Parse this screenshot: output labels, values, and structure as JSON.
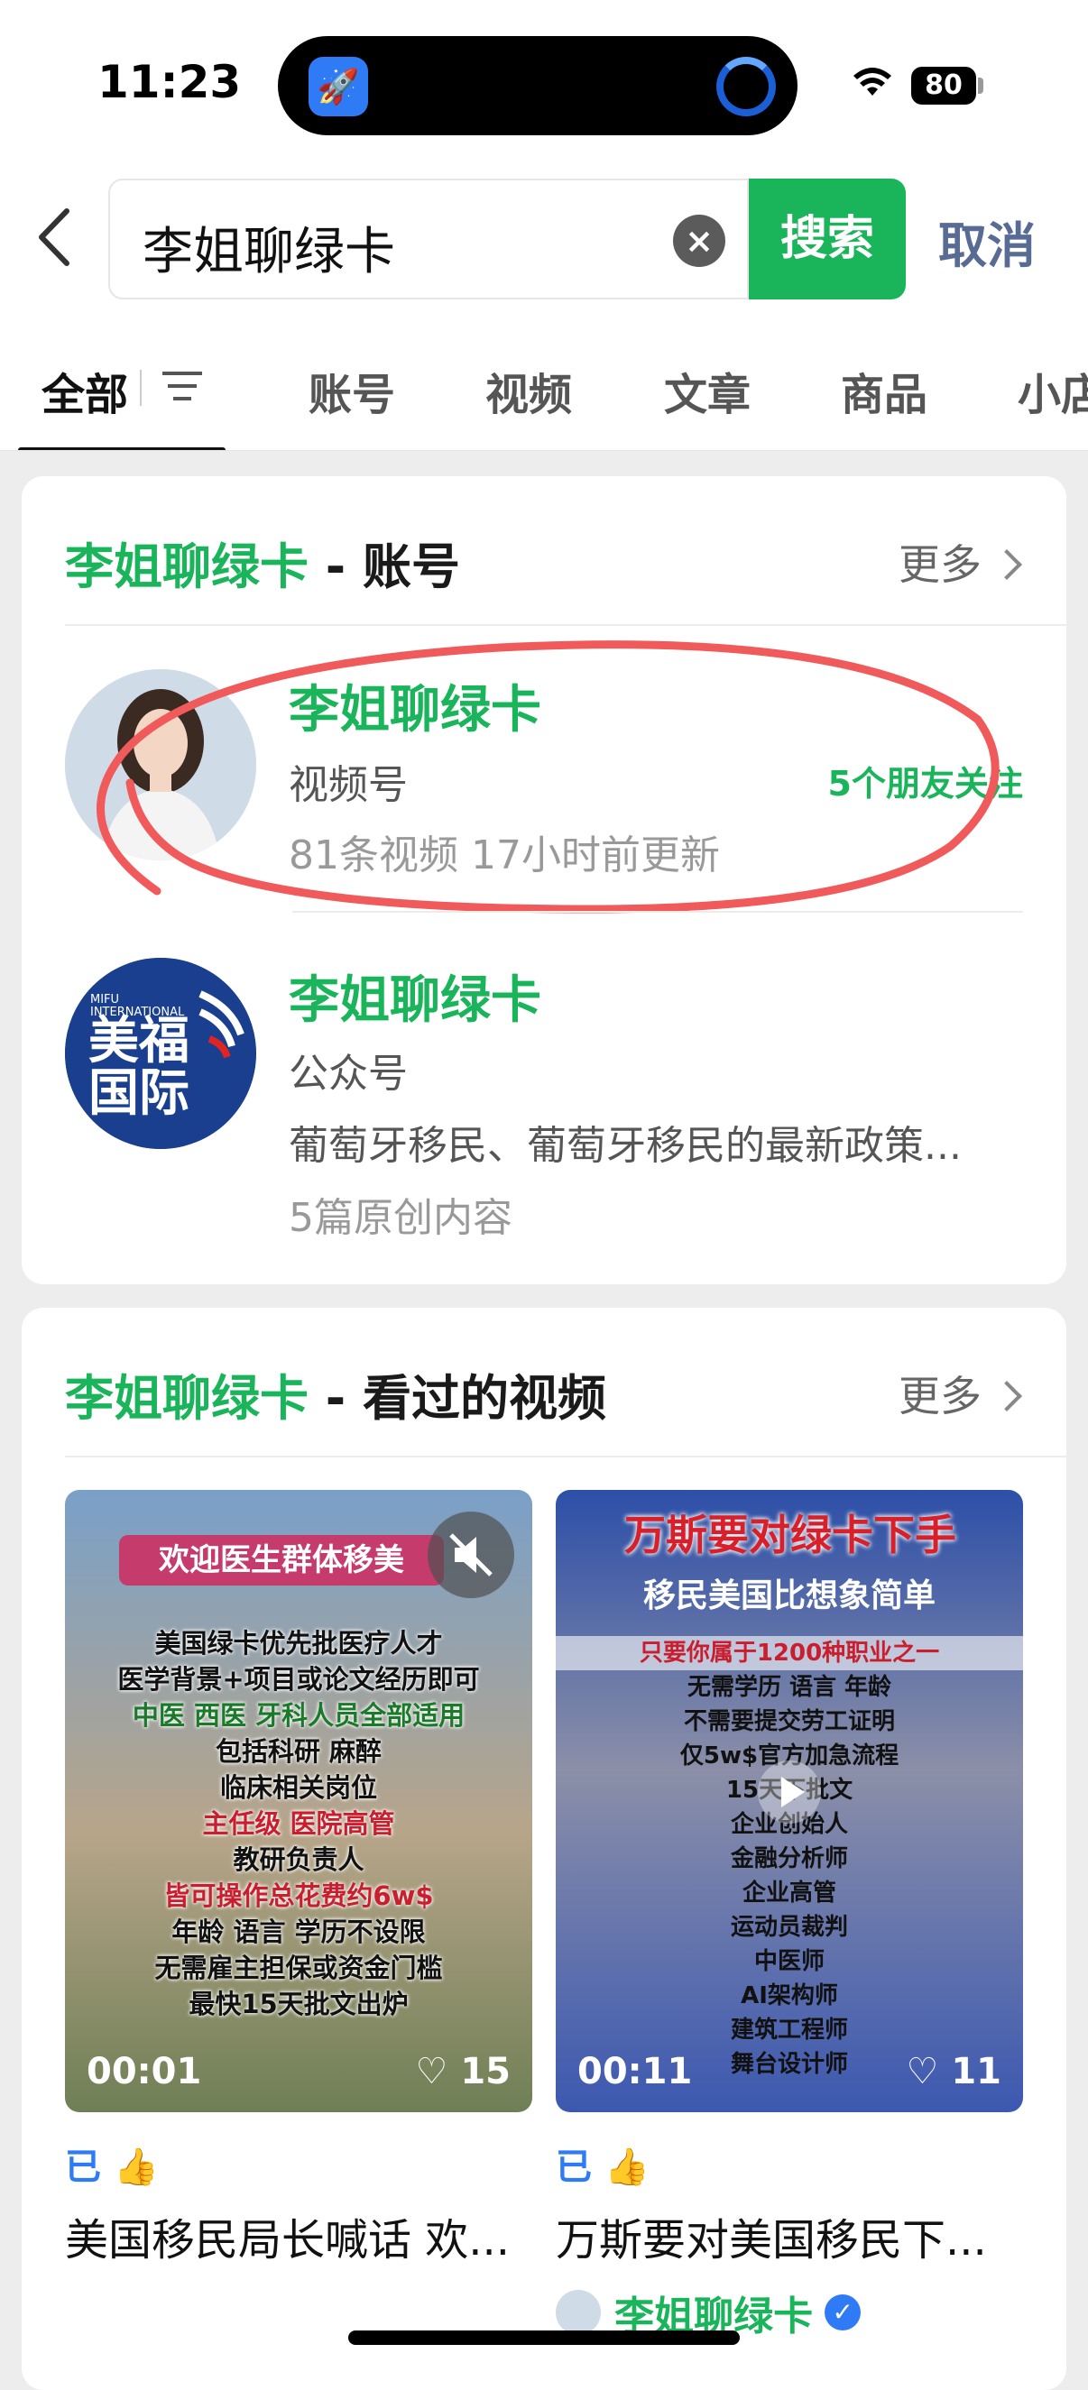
{
  "status": {
    "time": "11:23",
    "battery": "80"
  },
  "search": {
    "query": "李姐聊绿卡",
    "button": "搜索",
    "cancel": "取消"
  },
  "tabs": [
    "全部",
    "账号",
    "视频",
    "文章",
    "商品",
    "小店"
  ],
  "accounts_section": {
    "title_keyword": "李姐聊绿卡",
    "title_suffix": " - 账号",
    "more": "更多",
    "items": [
      {
        "name": "李姐聊绿卡",
        "type": "视频号",
        "meta": "81条视频  17小时前更新",
        "follow": "5个朋友关注"
      },
      {
        "name": "李姐聊绿卡",
        "type": "公众号",
        "desc": "葡萄牙移民、葡萄牙移民的最新政策...",
        "meta": "5篇原创内容",
        "logo_en": "MIFU INTERNATIONAL",
        "logo_cn_1": "美福",
        "logo_cn_2": "国际"
      }
    ]
  },
  "videos_section": {
    "title_keyword": "李姐聊绿卡",
    "title_suffix": " - 看过的视频",
    "more": "更多",
    "items": [
      {
        "duration": "00:01",
        "likes": "15",
        "liked": "已",
        "title": "美国移民局长喊话 欢...",
        "banner": "欢迎医生群体移美",
        "lines": [
          "美国绿卡优先批医疗人才",
          "医学背景+项目或论文经历即可",
          "中医 西医 牙科人员全部适用",
          "包括科研 麻醉",
          "临床相关岗位",
          "主任级 医院高管",
          "教研负责人",
          "皆可操作总花费约6w$",
          "年龄 语言 学历不设限",
          "无需雇主担保或资金门槛",
          "最快15天批文出炉"
        ]
      },
      {
        "duration": "00:11",
        "likes": "11",
        "liked": "已",
        "title": "万斯要对美国移民下...",
        "banner": "万斯要对绿卡下手",
        "sub_banner": "移民美国比想象简单",
        "lines": [
          "只要你属于1200种职业之一",
          "无需学历 语言 年龄",
          "不需要提交劳工证明",
          "仅5w$官方加急流程",
          "15天下批文",
          "企业创始人",
          "金融分析师",
          "企业高管",
          "运动员裁判",
          "中医师",
          "AI架构师",
          "建筑工程师",
          "舞台设计师"
        ],
        "author": "李姐聊绿卡"
      }
    ]
  },
  "colors": {
    "accent_green": "#1ab45a",
    "link_blue": "#576b95",
    "annotation_red": "#f05a5a"
  }
}
